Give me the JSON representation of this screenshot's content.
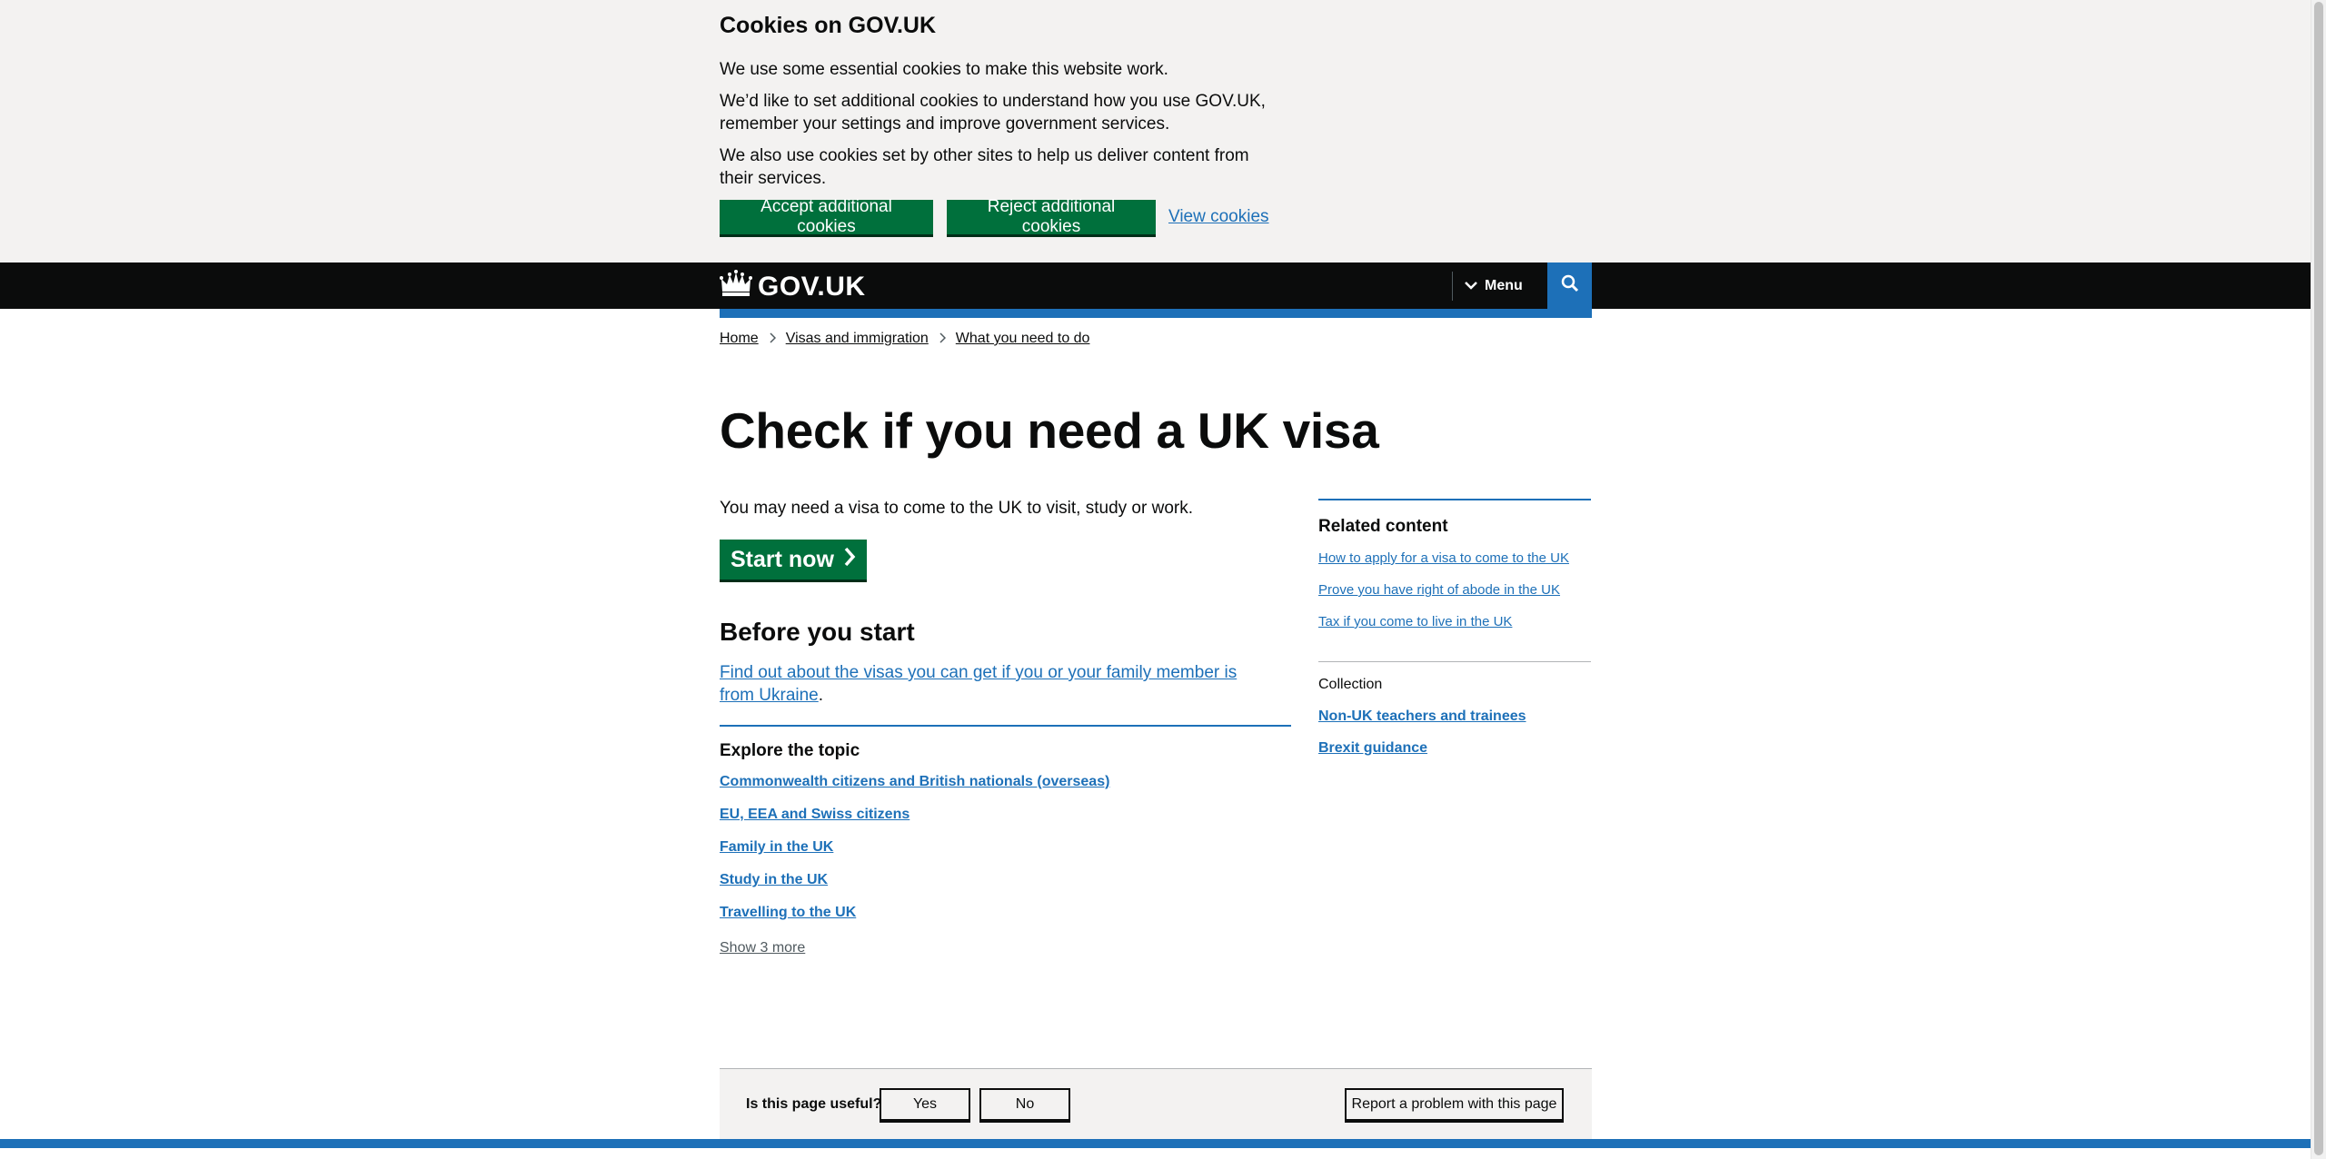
{
  "cookie_banner": {
    "title": "Cookies on GOV.UK",
    "p1": "We use some essential cookies to make this website work.",
    "p2": "We’d like to set additional cookies to understand how you use GOV.UK, remember your settings and improve government services.",
    "p3": "We also use cookies set by other sites to help us deliver content from their services.",
    "accept_label": "Accept additional cookies",
    "reject_label": "Reject additional cookies",
    "view_label": "View cookies"
  },
  "header": {
    "logo_text": "GOV.UK",
    "menu_label": "Menu",
    "search_icon": "search-icon"
  },
  "breadcrumbs": [
    "Home",
    "Visas and immigration",
    "What you need to do"
  ],
  "main": {
    "title": "Check if you need a UK visa",
    "intro": "You may need a visa to come to the UK to visit, study or work.",
    "start_label": "Start now",
    "before_heading": "Before you start",
    "before_link": "Find out about the visas you can get if you or your family member is from Ukraine",
    "before_suffix": ".",
    "explore_heading": "Explore the topic",
    "topics": [
      "Commonwealth citizens and British nationals (overseas)",
      "EU, EEA and Swiss citizens",
      "Family in the UK",
      "Study in the UK",
      "Travelling to the UK"
    ],
    "show_more": "Show 3 more"
  },
  "sidebar": {
    "related_heading": "Related content",
    "related": [
      "How to apply for a visa to come to the UK",
      "Prove you have right of abode in the UK",
      "Tax if you come to live in the UK"
    ],
    "collection_label": "Collection",
    "collections": [
      "Non-UK teachers and trainees",
      "Brexit guidance"
    ]
  },
  "feedback": {
    "question": "Is this page useful?",
    "yes": "Yes",
    "no": "No",
    "report": "Report a problem with this page"
  },
  "colors": {
    "brand_blue": "#1d70b8",
    "button_green": "#00703c",
    "header_black": "#0b0c0c",
    "banner_grey": "#f3f2f1"
  }
}
